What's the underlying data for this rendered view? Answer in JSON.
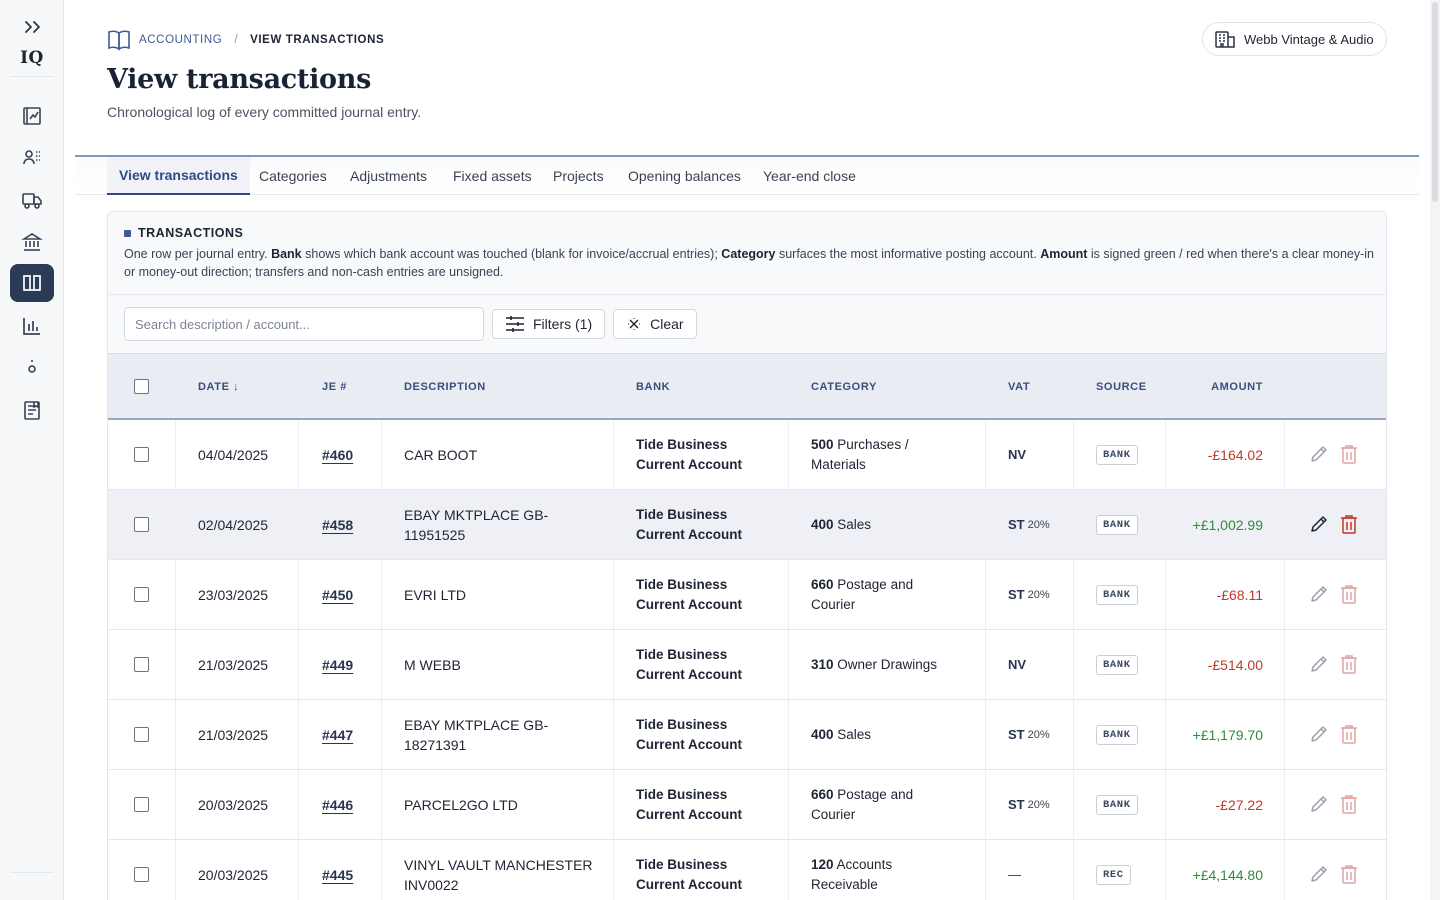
{
  "sidebar": {
    "logo": "IQ",
    "items": [
      {
        "icon": "ledger-chart-icon"
      },
      {
        "icon": "people-icon"
      },
      {
        "icon": "truck-icon"
      },
      {
        "icon": "bank-icon"
      },
      {
        "icon": "open-book-icon",
        "active": true
      },
      {
        "icon": "bar-chart-icon"
      },
      {
        "icon": "dot-icon"
      },
      {
        "icon": "receipt-icon"
      }
    ]
  },
  "breadcrumb": {
    "section": "ACCOUNTING",
    "separator": "/",
    "current": "VIEW TRANSACTIONS"
  },
  "page": {
    "title": "View transactions",
    "subtitle": "Chronological log of every committed journal entry."
  },
  "org": {
    "name": "Webb Vintage & Audio"
  },
  "tabs": [
    {
      "label": "View transactions",
      "active": true
    },
    {
      "label": "Categories"
    },
    {
      "label": "Adjustments"
    },
    {
      "label": "Fixed assets"
    },
    {
      "label": "Projects"
    },
    {
      "label": "Opening balances"
    },
    {
      "label": "Year-end close"
    }
  ],
  "card": {
    "title": "TRANSACTIONS",
    "desc": {
      "p1": "One row per journal entry. ",
      "b1": "Bank",
      "p2": " shows which bank account was touched (blank for invoice/accrual entries); ",
      "b2": "Category",
      "p3": " surfaces the most informative posting account. ",
      "b3": "Amount",
      "p4": " is signed green / red when there's a clear money-in or money-out direction; transfers and non-cash entries are unsigned."
    }
  },
  "toolbar": {
    "search_placeholder": "Search description / account...",
    "filters_label": "Filters (1)",
    "clear_label": "Clear"
  },
  "table": {
    "columns": {
      "date": "DATE ↓",
      "je": "JE #",
      "description": "DESCRIPTION",
      "bank": "BANK",
      "category": "CATEGORY",
      "vat": "VAT",
      "source": "SOURCE",
      "amount": "AMOUNT"
    },
    "rows": [
      {
        "date": "04/04/2025",
        "je": "#460",
        "desc1": "CAR BOOT",
        "desc2": "",
        "bank1": "Tide Business",
        "bank2": "Current Account",
        "cat_code": "500",
        "cat1": " Purchases /",
        "cat2": "Materials",
        "vat": "NV",
        "vat_rate": "",
        "source": "BANK",
        "amount": "-£164.02",
        "sign": "neg"
      },
      {
        "date": "02/04/2025",
        "je": "#458",
        "desc1": "EBAY MKTPLACE GB-11951525",
        "desc2": "",
        "bank1": "Tide Business",
        "bank2": "Current Account",
        "cat_code": "400",
        "cat1": " Sales",
        "cat2": "",
        "vat": "ST",
        "vat_rate": "20%",
        "source": "BANK",
        "amount": "+£1,002.99",
        "sign": "pos",
        "hover": true
      },
      {
        "date": "23/03/2025",
        "je": "#450",
        "desc1": "EVRI LTD",
        "desc2": "",
        "bank1": "Tide Business",
        "bank2": "Current Account",
        "cat_code": "660",
        "cat1": " Postage and",
        "cat2": "Courier",
        "vat": "ST",
        "vat_rate": "20%",
        "source": "BANK",
        "amount": "-£68.11",
        "sign": "neg"
      },
      {
        "date": "21/03/2025",
        "je": "#449",
        "desc1": "M WEBB",
        "desc2": "",
        "bank1": "Tide Business",
        "bank2": "Current Account",
        "cat_code": "310",
        "cat1": " Owner Drawings",
        "cat2": "",
        "vat": "NV",
        "vat_rate": "",
        "source": "BANK",
        "amount": "-£514.00",
        "sign": "neg"
      },
      {
        "date": "21/03/2025",
        "je": "#447",
        "desc1": "EBAY MKTPLACE GB-18271391",
        "desc2": "",
        "bank1": "Tide Business",
        "bank2": "Current Account",
        "cat_code": "400",
        "cat1": " Sales",
        "cat2": "",
        "vat": "ST",
        "vat_rate": "20%",
        "source": "BANK",
        "amount": "+£1,179.70",
        "sign": "pos"
      },
      {
        "date": "20/03/2025",
        "je": "#446",
        "desc1": "PARCEL2GO LTD",
        "desc2": "",
        "bank1": "Tide Business",
        "bank2": "Current Account",
        "cat_code": "660",
        "cat1": " Postage and",
        "cat2": "Courier",
        "vat": "ST",
        "vat_rate": "20%",
        "source": "BANK",
        "amount": "-£27.22",
        "sign": "neg"
      },
      {
        "date": "20/03/2025",
        "je": "#445",
        "desc1": "VINYL VAULT MANCHESTER",
        "desc2": "INV0022",
        "bank1": "Tide Business",
        "bank2": "Current Account",
        "cat_code": "120",
        "cat1": " Accounts",
        "cat2": "Receivable",
        "vat": "—",
        "vat_rate": "",
        "source": "REC",
        "amount": "+£4,144.80",
        "sign": "pos"
      }
    ]
  },
  "colors": {
    "accent": "#2b3a55",
    "negative": "#c0392b",
    "positive": "#2e8b3e"
  }
}
